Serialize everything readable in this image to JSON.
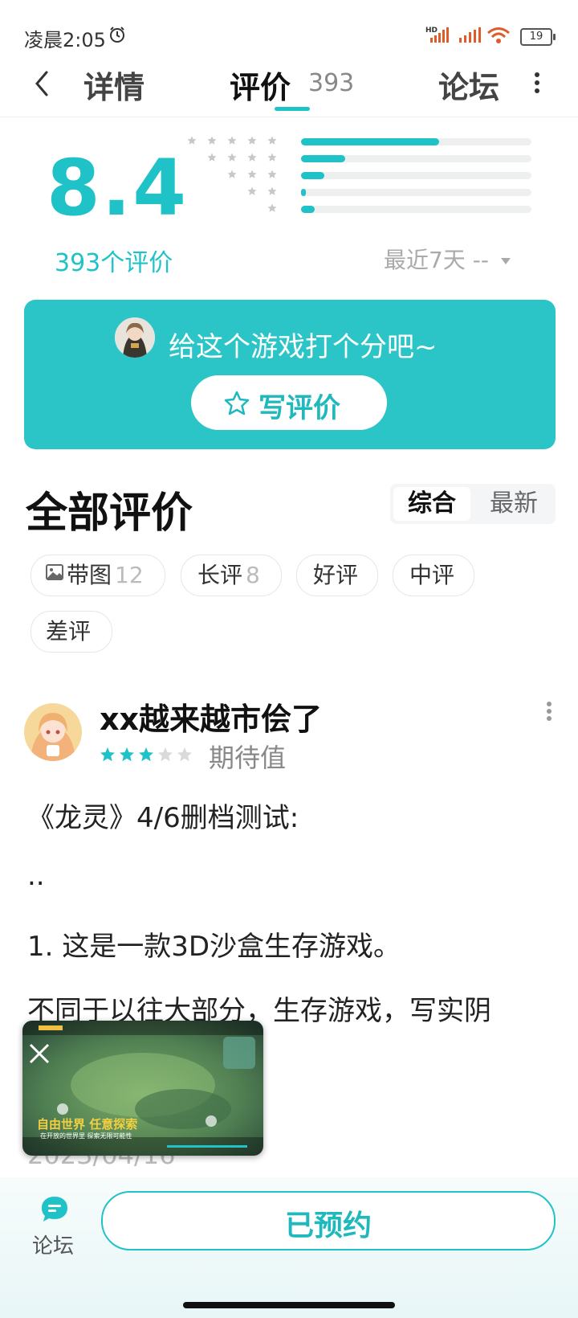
{
  "status_bar": {
    "time": "凌晨2:05",
    "battery": "19"
  },
  "nav": {
    "tab_detail": "详情",
    "tab_reviews": "评价",
    "tab_reviews_count": "393",
    "tab_forum": "论坛"
  },
  "rating": {
    "score": "8.4",
    "count_label": "393个评价",
    "distribution": [
      {
        "stars": 5,
        "fraction": 0.6
      },
      {
        "stars": 4,
        "fraction": 0.19
      },
      {
        "stars": 3,
        "fraction": 0.1
      },
      {
        "stars": 2,
        "fraction": 0.02
      },
      {
        "stars": 1,
        "fraction": 0.06
      }
    ],
    "recent_label": "最近7天 --",
    "accent_color": "#1fc3c7"
  },
  "write_card": {
    "prompt": "给这个游戏打个分吧~",
    "button_label": "写评价"
  },
  "reviews_section": {
    "title": "全部评价",
    "sort_options": [
      "综合",
      "最新"
    ],
    "sort_selected": "综合",
    "filters": [
      {
        "label": "带图",
        "count": "12"
      },
      {
        "label": "长评",
        "count": "8"
      },
      {
        "label": "好评",
        "count": ""
      },
      {
        "label": "中评",
        "count": ""
      },
      {
        "label": "差评",
        "count": ""
      }
    ]
  },
  "review": {
    "username": "xx越来越市侩了",
    "stars": 3,
    "max_stars": 5,
    "tag": "期待值",
    "lines": [
      "《龙灵》4/6删档测试:",
      "..",
      "1. 这是一款3D沙盒生存游戏。",
      "不同于以往大部分，生存游戏，写实阴"
    ],
    "date": "2023/04/16",
    "video_caption_title": "自由世界 任意探索",
    "video_caption_sub": "在开放的世界里 探索无限可能性"
  },
  "bottom_bar": {
    "forum_label": "论坛",
    "reserved_label": "已预约"
  }
}
